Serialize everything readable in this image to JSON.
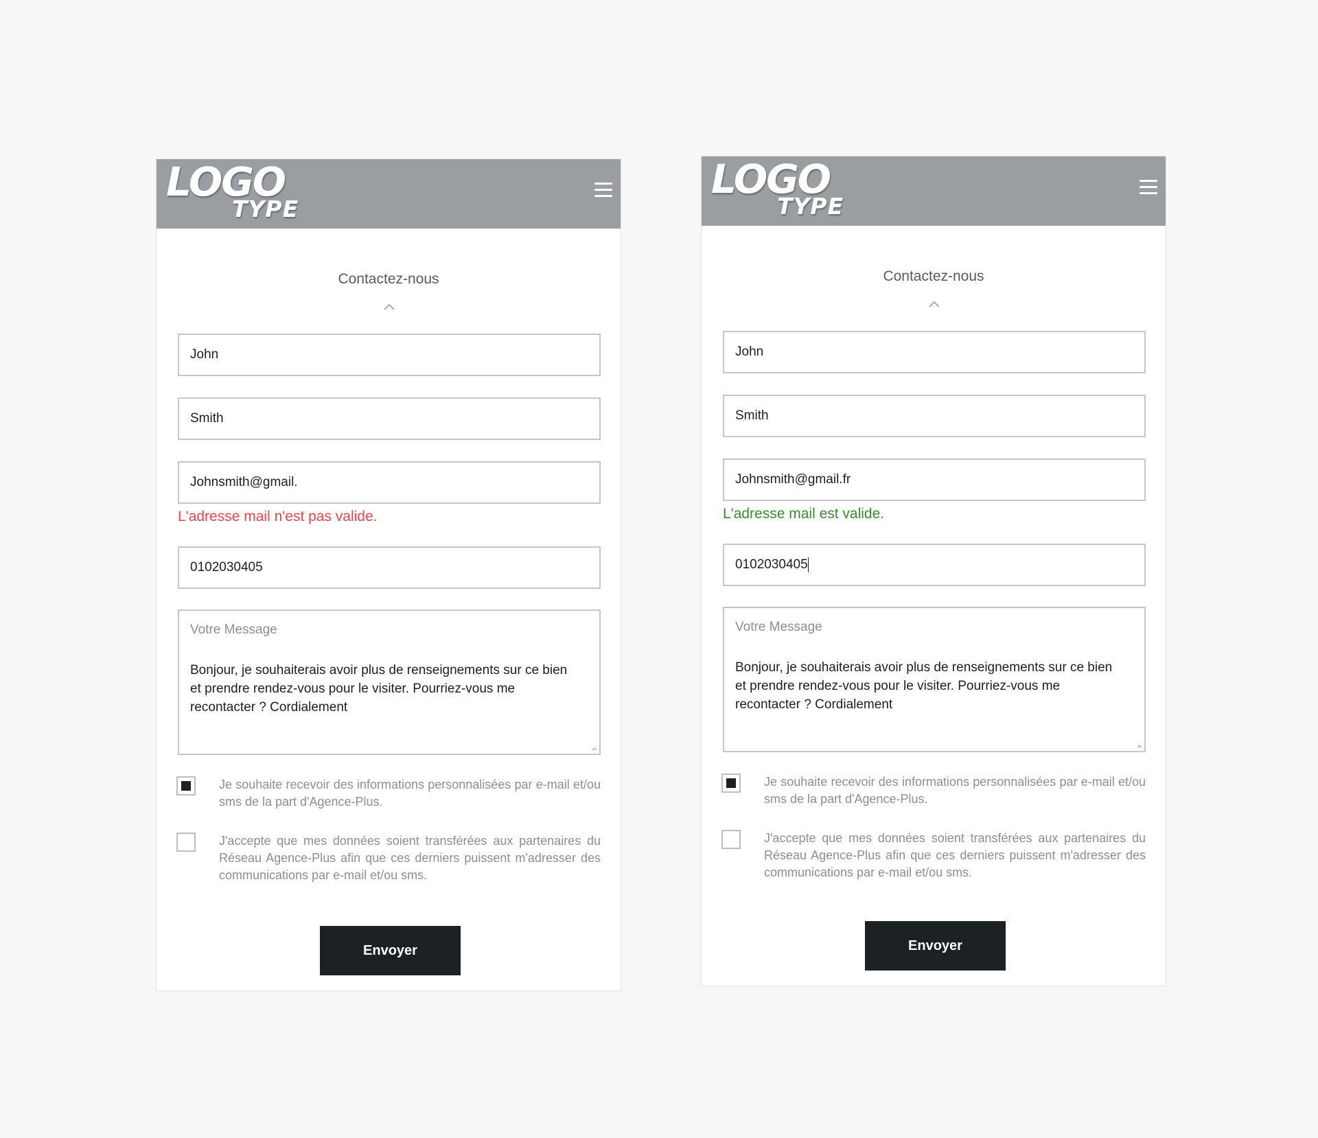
{
  "screens": [
    {
      "logo": {
        "line1": "LOGO",
        "line2": "TYPE"
      },
      "section_title": "Contactez-nous",
      "form": {
        "first_name": "John",
        "last_name": "Smith",
        "email": "Johnsmith@gmail.",
        "email_status": "L'adresse mail n'est pas valide.",
        "email_status_type": "invalid",
        "phone": "0102030405",
        "message_placeholder": "Votre Message",
        "message": "Bonjour, je souhaiterais avoir plus de renseignements sur ce bien et prendre rendez-vous pour le visiter. Pourriez-vous me recontacter ? Cordialement",
        "consent_marketing": {
          "checked": true,
          "label": "Je souhaite recevoir des informations personnalisées par e-mail et/ou sms de la part d'Agence-Plus."
        },
        "consent_partners": {
          "checked": false,
          "label": "J'accepte que mes données soient transférées aux partenaires du Réseau Agence-Plus afin que ces derniers puissent m'adresser des communications par e-mail et/ou sms."
        },
        "submit_label": "Envoyer"
      }
    },
    {
      "logo": {
        "line1": "LOGO",
        "line2": "TYPE"
      },
      "section_title": "Contactez-nous",
      "form": {
        "first_name": "John",
        "last_name": "Smith",
        "email": "Johnsmith@gmail.fr",
        "email_status": "L'adresse mail est valide.",
        "email_status_type": "valid",
        "phone": "0102030405",
        "message_placeholder": "Votre Message",
        "message": "Bonjour, je souhaiterais avoir plus de renseignements sur ce bien et prendre rendez-vous pour le visiter. Pourriez-vous me recontacter ? Cordialement",
        "consent_marketing": {
          "checked": true,
          "label": "Je souhaite recevoir des informations personnalisées par e-mail et/ou sms de la part d'Agence-Plus."
        },
        "consent_partners": {
          "checked": false,
          "label": "J'accepte que mes données soient transférées aux partenaires du Réseau Agence-Plus afin que ces derniers puissent m'adresser des communications par e-mail et/ou sms."
        },
        "submit_label": "Envoyer"
      }
    }
  ],
  "colors": {
    "header_bg": "#9a9ea1",
    "invalid": "#e8454b",
    "valid": "#3a8a2f",
    "button_bg": "#1e2124"
  },
  "icons": {
    "menu": "hamburger-menu-icon",
    "chevron": "chevron-up-icon",
    "checkbox_checked": "checkbox-checked-icon"
  }
}
